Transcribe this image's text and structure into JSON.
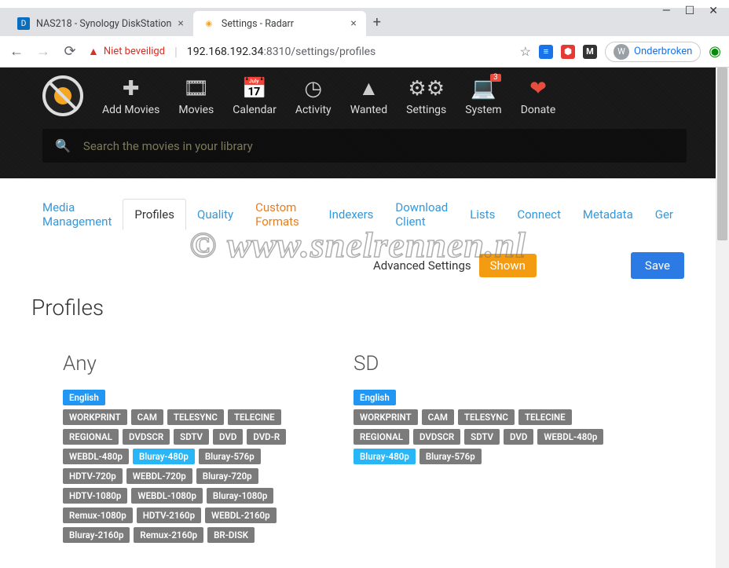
{
  "window": {
    "tabs": [
      {
        "title": "NAS218 - Synology DiskStation",
        "active": false
      },
      {
        "title": "Settings - Radarr",
        "active": true
      }
    ]
  },
  "address": {
    "warning_label": "Niet beveiligd",
    "host": "192.168.192.34",
    "port": ":8310",
    "path": "/settings/profiles",
    "user_label": "Onderbroken",
    "user_initial": "W"
  },
  "nav": {
    "items": [
      {
        "label": "Add Movies",
        "icon": "plus"
      },
      {
        "label": "Movies",
        "icon": "film"
      },
      {
        "label": "Calendar",
        "icon": "calendar"
      },
      {
        "label": "Activity",
        "icon": "clock"
      },
      {
        "label": "Wanted",
        "icon": "warning"
      },
      {
        "label": "Settings",
        "icon": "gears"
      },
      {
        "label": "System",
        "icon": "laptop",
        "badge": "3"
      },
      {
        "label": "Donate",
        "icon": "heart"
      }
    ],
    "search_placeholder": "Search the movies in your library"
  },
  "subnav": {
    "items": [
      "Media Management",
      "Profiles",
      "Quality",
      "Custom Formats",
      "Indexers",
      "Download Client",
      "Lists",
      "Connect",
      "Metadata",
      "Ger"
    ],
    "active": "Profiles",
    "orange": "Custom Formats"
  },
  "toolbar": {
    "advanced_label": "Advanced Settings",
    "shown_label": "Shown",
    "save_label": "Save"
  },
  "page_title": "Profiles",
  "watermark": "© www.snelrennen.nl",
  "profiles": [
    {
      "name": "Any",
      "language": "English",
      "cutoff": "Bluray-480p",
      "qualities": [
        "WORKPRINT",
        "CAM",
        "TELESYNC",
        "TELECINE",
        "REGIONAL",
        "DVDSCR",
        "SDTV",
        "DVD",
        "DVD-R",
        "WEBDL-480p",
        "Bluray-480p",
        "Bluray-576p",
        "HDTV-720p",
        "WEBDL-720p",
        "Bluray-720p",
        "HDTV-1080p",
        "WEBDL-1080p",
        "Bluray-1080p",
        "Remux-1080p",
        "HDTV-2160p",
        "WEBDL-2160p",
        "Bluray-2160p",
        "Remux-2160p",
        "BR-DISK"
      ]
    },
    {
      "name": "SD",
      "language": "English",
      "cutoff": "Bluray-480p",
      "qualities": [
        "WORKPRINT",
        "CAM",
        "TELESYNC",
        "TELECINE",
        "REGIONAL",
        "DVDSCR",
        "SDTV",
        "DVD",
        "WEBDL-480p",
        "Bluray-480p",
        "Bluray-576p"
      ]
    }
  ]
}
